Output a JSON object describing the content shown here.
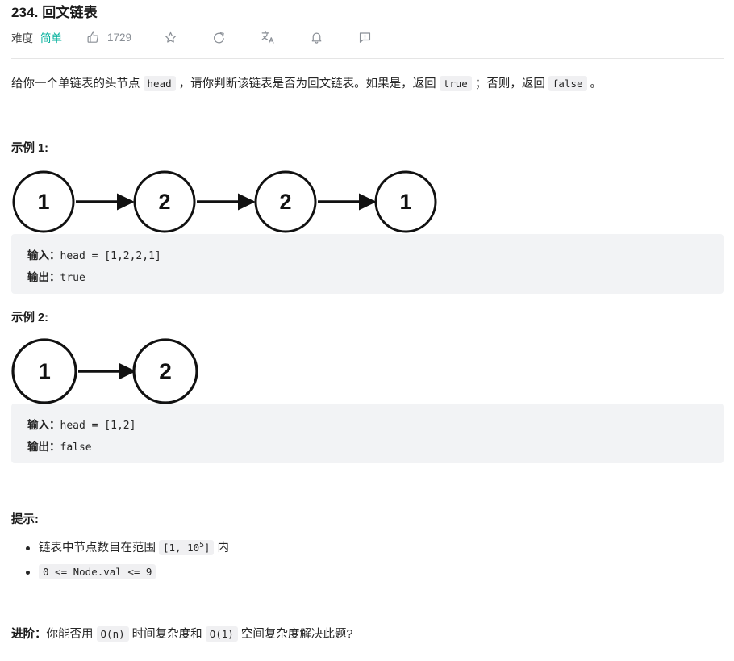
{
  "header": {
    "title": "234. 回文链表",
    "difficulty_label": "难度",
    "difficulty_value": "简单",
    "like_count": "1729",
    "icons": {
      "like": "thumbs-up-icon",
      "favorite": "star-icon",
      "share": "share-icon",
      "translate": "translate-icon",
      "notification": "bell-icon",
      "feedback": "feedback-icon"
    },
    "accent_color": "#00af9b"
  },
  "description": {
    "part1": "给你一个单链表的头节点 ",
    "code1": "head",
    "part2": " ，请你判断该链表是否为回文链表。如果是，返回 ",
    "code2": "true",
    "part3": " ；否则，返回 ",
    "code3": "false",
    "part4": " 。"
  },
  "examples": [
    {
      "heading": "示例 1:",
      "nodes": [
        "1",
        "2",
        "2",
        "1"
      ],
      "input_label": "输入：",
      "input_value": "head = [1,2,2,1]",
      "output_label": "输出：",
      "output_value": "true"
    },
    {
      "heading": "示例 2:",
      "nodes": [
        "1",
        "2"
      ],
      "input_label": "输入：",
      "input_value": "head = [1,2]",
      "output_label": "输出：",
      "output_value": "false"
    }
  ],
  "hints": {
    "heading": "提示:",
    "items": [
      {
        "prefix": "链表中节点数目在范围 ",
        "code_pre": "[1, 10",
        "code_sup": "5",
        "code_post": "]",
        "suffix": " 内"
      },
      {
        "prefix": "",
        "code_pre": "0 <= Node.val <= 9",
        "code_sup": "",
        "code_post": "",
        "suffix": ""
      }
    ]
  },
  "followup": {
    "label": "进阶：",
    "part1": "你能否用 ",
    "code1": "O(n)",
    "part2": " 时间复杂度和 ",
    "code2": "O(1)",
    "part3": " 空间复杂度解决此题?"
  }
}
